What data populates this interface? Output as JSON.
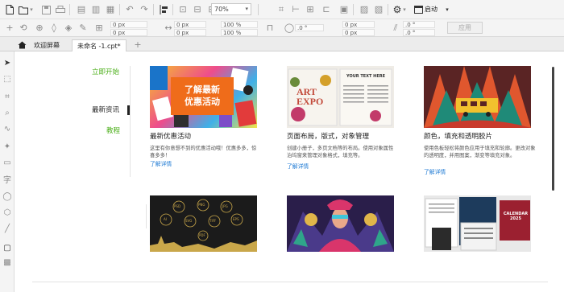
{
  "toolbar": {
    "zoom": "70%",
    "start_label": "启动",
    "apply_label": "应用",
    "fields": {
      "x": "0 px",
      "y": "0 px",
      "w": "0 px",
      "h": "0 px",
      "scale_w": "100 %",
      "scale_h": "100 %",
      "rotate": ".0 °",
      "pos_x": "0 px",
      "pos_y": "0 px",
      "angle_a": ".0 °",
      "angle_b": ".0 °"
    }
  },
  "tabs": [
    {
      "label": "欢迎屏幕"
    },
    {
      "label": "未命名 -1.cpt*"
    }
  ],
  "nav": {
    "items": [
      {
        "label": "立即开始",
        "color": "#4caf1a"
      },
      {
        "label": "最新资讯",
        "color": "#222222",
        "active": true
      },
      {
        "label": "教程",
        "color": "#4caf1a"
      }
    ]
  },
  "cards": [
    {
      "title": "最新优惠活动",
      "desc": "这里有你意想不到的优惠活动哦！优惠多多，惊喜多多！",
      "link": "了解详情",
      "image_caption_line1": "了解最新",
      "image_caption_line2": "优惠活动"
    },
    {
      "title": "页面布局，版式，对象管理",
      "desc": "创建小册子，多页文档等的布局。使用对象属性泊坞窗来管理对象格式，填充等。",
      "link": "了解详情",
      "image_text_main": "ART EXPO",
      "image_text_side": "YOUR TEXT HERE"
    },
    {
      "title": "颜色，填充和透明胶片",
      "desc": "使用色板轻松将颜色应用于填充和轮廓。更改对象的透明度，并用图案，渐变等填充对象。",
      "link": "了解详情"
    }
  ],
  "bottom_cards": [
    {
      "labels": [
        "PSD",
        "PNG",
        "JPG",
        "SVG",
        "TIFF",
        "EPS",
        "AI",
        "PDF"
      ]
    },
    {},
    {
      "image_text": "CALENDAR 2025"
    }
  ],
  "colors": {
    "accent_green": "#4caf1a",
    "link_blue": "#1e7ad4",
    "promo_orange": "#ef6c1a"
  }
}
